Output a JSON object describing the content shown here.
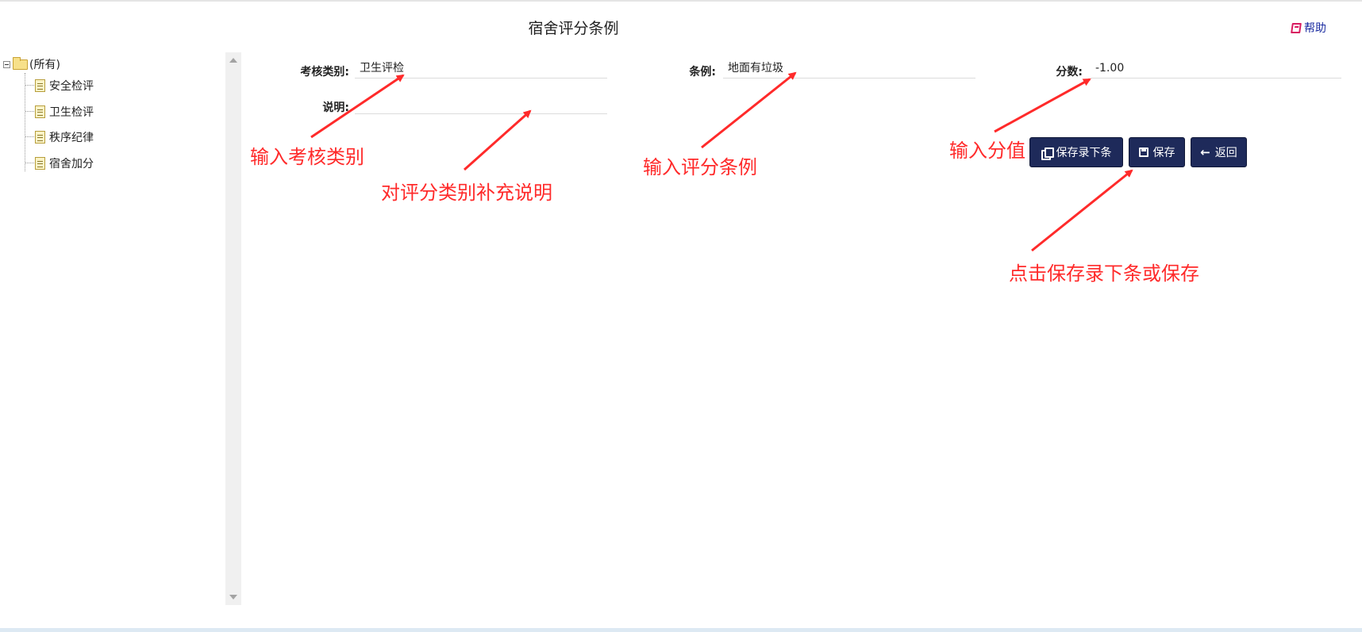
{
  "header": {
    "title": "宿舍评分条例",
    "help_label": "帮助"
  },
  "tree": {
    "root_label": "(所有)",
    "items": [
      {
        "label": "安全检评"
      },
      {
        "label": "卫生检评"
      },
      {
        "label": "秩序纪律"
      },
      {
        "label": "宿舍加分"
      }
    ]
  },
  "form": {
    "category_label": "考核类别:",
    "category_value": "卫生评检",
    "rule_label": "条例:",
    "rule_value": "地面有垃圾",
    "score_label": "分数:",
    "score_value": "-1.00",
    "description_label": "说明:",
    "description_value": ""
  },
  "buttons": {
    "save_next_label": "保存录下条",
    "save_label": "保存",
    "back_label": "返回"
  },
  "annotations": {
    "category_note": "输入考核类别",
    "description_note": "对评分类别补充说明",
    "rule_note": "输入评分条例",
    "score_note": "输入分值",
    "save_note": "点击保存录下条或保存",
    "color": "#ff2a2a"
  },
  "colors": {
    "button_bg": "#1e2a5a",
    "help_link": "#1a2ba0",
    "help_icon": "#d81b60"
  }
}
